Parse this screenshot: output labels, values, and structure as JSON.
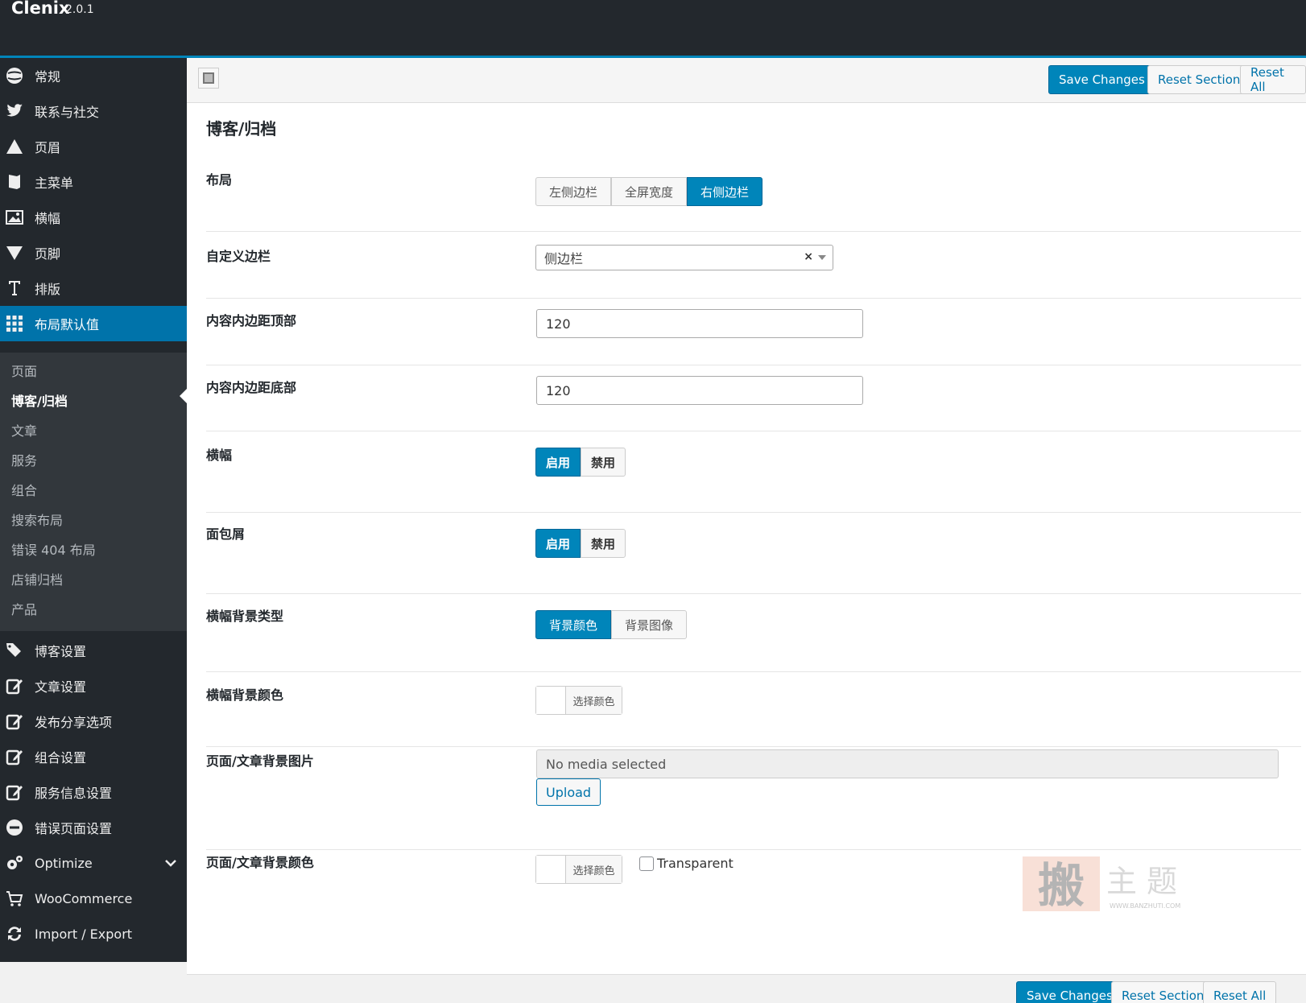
{
  "header": {
    "title": "Clenix",
    "version": "2.0.1"
  },
  "sidebar": {
    "items": [
      {
        "label": "常规",
        "icon": "globe-icon"
      },
      {
        "label": "联系与社交",
        "icon": "twitter-icon"
      },
      {
        "label": "页眉",
        "icon": "triangle-up-icon"
      },
      {
        "label": "主菜单",
        "icon": "book-icon"
      },
      {
        "label": "横幅",
        "icon": "image-icon"
      },
      {
        "label": "页脚",
        "icon": "triangle-down-icon"
      },
      {
        "label": "排版",
        "icon": "text-icon"
      },
      {
        "label": "布局默认值",
        "icon": "grid-icon",
        "active": true
      },
      {
        "label": "博客设置",
        "icon": "tags-icon"
      },
      {
        "label": "文章设置",
        "icon": "edit-icon"
      },
      {
        "label": "发布分享选项",
        "icon": "edit-icon"
      },
      {
        "label": "组合设置",
        "icon": "edit-icon"
      },
      {
        "label": "服务信息设置",
        "icon": "edit-icon"
      },
      {
        "label": "错误页面设置",
        "icon": "minus-circle-icon"
      },
      {
        "label": "Optimize",
        "icon": "gears-icon"
      },
      {
        "label": "WooCommerce",
        "icon": "cart-icon"
      },
      {
        "label": "Import / Export",
        "icon": "refresh-icon"
      }
    ],
    "submenu": [
      "页面",
      "博客/归档",
      "文章",
      "服务",
      "组合",
      "搜索布局",
      "错误 404 布局",
      "店铺归档",
      "产品"
    ],
    "submenu_current": "博客/归档"
  },
  "toolbar": {
    "save": "Save Changes",
    "reset_section": "Reset Section",
    "reset_all": "Reset All"
  },
  "section": {
    "title": "博客/归档",
    "layout": {
      "label": "布局",
      "options": [
        "左侧边栏",
        "全屏宽度",
        "右侧边栏"
      ],
      "selected": "右侧边栏"
    },
    "custom_sidebar": {
      "label": "自定义边栏",
      "value": "侧边栏",
      "clear": "×"
    },
    "padding_top": {
      "label": "内容内边距顶部",
      "value": "120"
    },
    "padding_bottom": {
      "label": "内容内边距底部",
      "value": "120"
    },
    "banner": {
      "label": "横幅",
      "options": [
        "启用",
        "禁用"
      ],
      "selected": "启用"
    },
    "breadcrumb": {
      "label": "面包屑",
      "options": [
        "启用",
        "禁用"
      ],
      "selected": "启用"
    },
    "banner_bg_type": {
      "label": "横幅背景类型",
      "options": [
        "背景颜色",
        "背景图像"
      ],
      "selected": "背景颜色"
    },
    "banner_bg_color": {
      "label": "横幅背景颜色",
      "button": "选择颜色",
      "swatch": "#ffffff"
    },
    "bg_image": {
      "label": "页面/文章背景图片",
      "placeholder": "No media selected",
      "upload": "Upload"
    },
    "bg_color": {
      "label": "页面/文章背景颜色",
      "button": "选择颜色",
      "swatch": "#ffffff",
      "transparent": "Transparent"
    }
  },
  "watermark": {
    "logo": "搬",
    "text": "主题",
    "url": "WWW.BANZHUTI.COM"
  },
  "colors": {
    "accent": "#0085ba",
    "sidebar": "#23282d",
    "submenu": "#32373c"
  }
}
